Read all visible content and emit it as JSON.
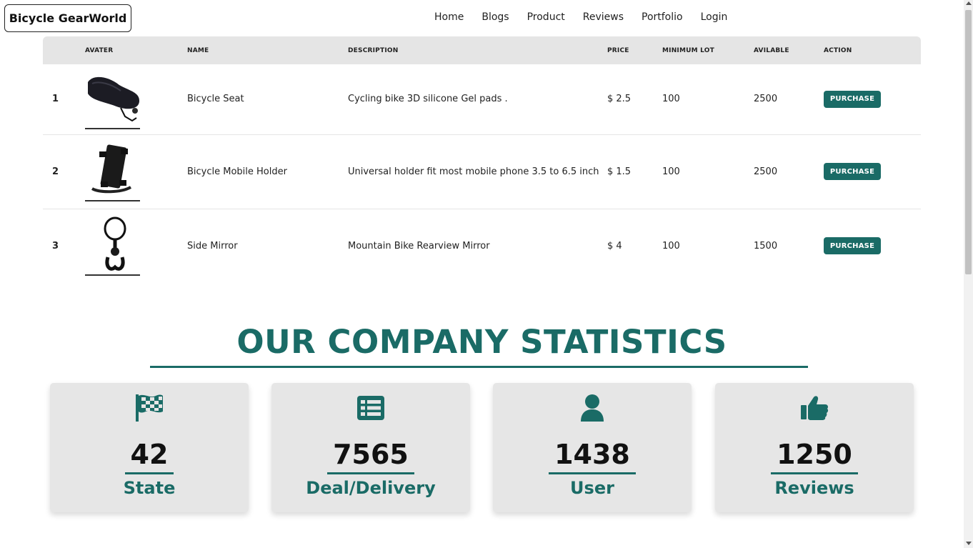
{
  "header": {
    "brand": "Bicycle GearWorld",
    "nav": [
      "Home",
      "Blogs",
      "Product",
      "Reviews",
      "Portfolio",
      "Login"
    ]
  },
  "table": {
    "headers": [
      "",
      "AVATER",
      "NAME",
      "DESCRIPTION",
      "PRICE",
      "MINIMUM LOT",
      "AVILABLE",
      "ACTION"
    ],
    "rows": [
      {
        "index": "1",
        "avatar_icon": "bicycle-seat-image",
        "name": "Bicycle Seat",
        "description": "Cycling bike 3D silicone Gel pads .",
        "price": "$ 2.5",
        "min_lot": "100",
        "available": "2500",
        "action": "PURCHASE"
      },
      {
        "index": "2",
        "avatar_icon": "mobile-holder-image",
        "name": "Bicycle Mobile Holder",
        "description": "Universal holder fit most mobile phone 3.5 to 6.5 inch",
        "price": "$ 1.5",
        "min_lot": "100",
        "available": "2500",
        "action": "PURCHASE"
      },
      {
        "index": "3",
        "avatar_icon": "side-mirror-image",
        "name": "Side Mirror",
        "description": "Mountain Bike Rearview Mirror",
        "price": "$ 4",
        "min_lot": "100",
        "available": "1500",
        "action": "PURCHASE"
      }
    ]
  },
  "stats": {
    "title": "OUR COMPANY STATISTICS",
    "cards": [
      {
        "icon": "checkered-flag-icon",
        "value": "42",
        "label": "State"
      },
      {
        "icon": "list-icon",
        "value": "7565",
        "label": "Deal/Delivery"
      },
      {
        "icon": "user-icon",
        "value": "1438",
        "label": "User"
      },
      {
        "icon": "thumbs-up-icon",
        "value": "1250",
        "label": "Reviews"
      }
    ]
  },
  "colors": {
    "accent": "#1a6b66",
    "header_bg": "#e5e5e5",
    "card_bg": "#e6e6e6"
  }
}
